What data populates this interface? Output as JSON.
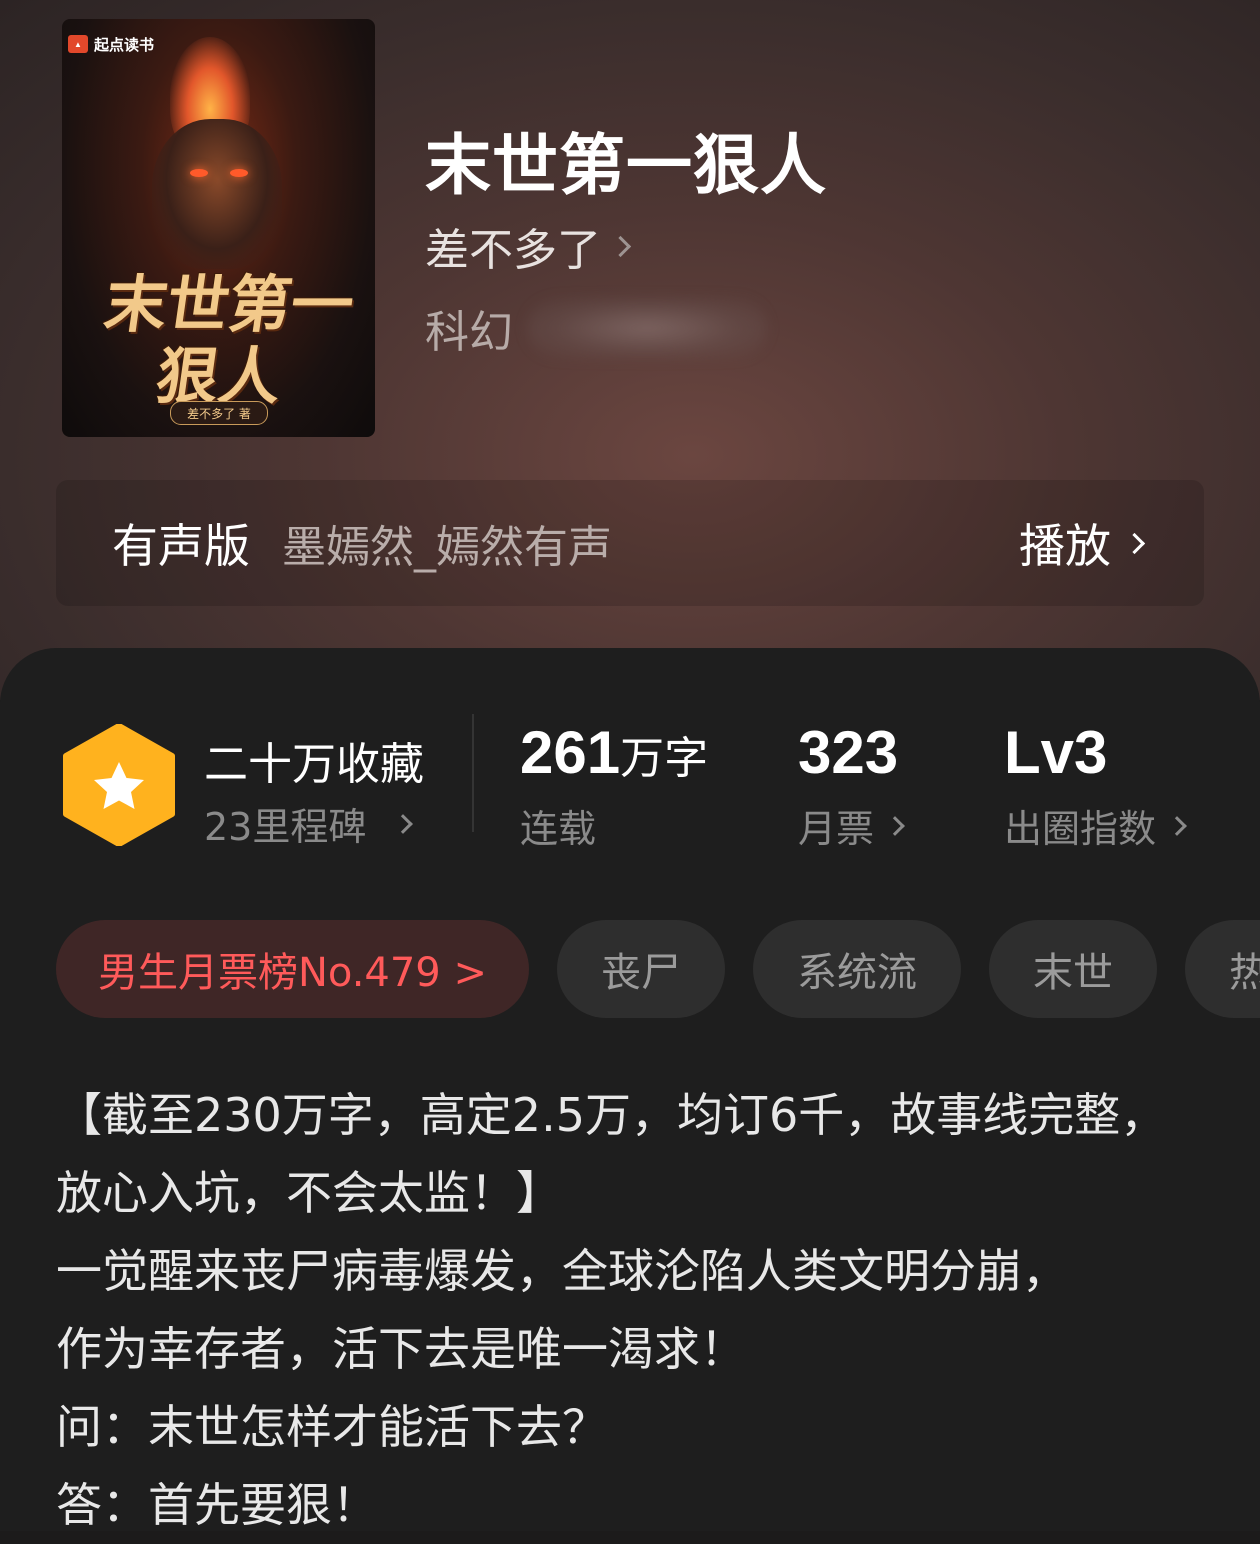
{
  "book": {
    "title": "末世第一狠人",
    "author": "差不多了",
    "category": "科幻",
    "cover": {
      "publisher_badge": "起点读书",
      "title_art": "末世第一狠人",
      "author_art": "差不多了 著"
    }
  },
  "audio": {
    "label": "有声版",
    "narrator": "墨嫣然_嫣然有声",
    "play_label": "播放"
  },
  "stats": {
    "collections": "二十万收藏",
    "milestones": "23里程碑",
    "word_count": "261",
    "word_unit": "万字",
    "status": "连载",
    "monthly_tickets": "323",
    "monthly_tickets_label": "月票",
    "level": "Lv3",
    "level_label": "出圈指数"
  },
  "tags": [
    "男生月票榜No.479 >",
    "丧尸",
    "系统流",
    "末世",
    "热"
  ],
  "description": [
    "【截至230万字，高定2.5万，均订6千，故事线完整，",
    "放心入坑，不会太监！】",
    "一觉醒来丧尸病毒爆发，全球沦陷人类文明分崩，",
    "作为幸存者，活下去是唯一渴求！",
    "问：末世怎样才能活下去？",
    "答：首先要狠！"
  ],
  "colors": {
    "hero_bg": "#4e3633",
    "panel_bg": "#1e1e1e",
    "rank_tag_text": "#ff5a5a",
    "badge_hex": "#ffb21e"
  }
}
